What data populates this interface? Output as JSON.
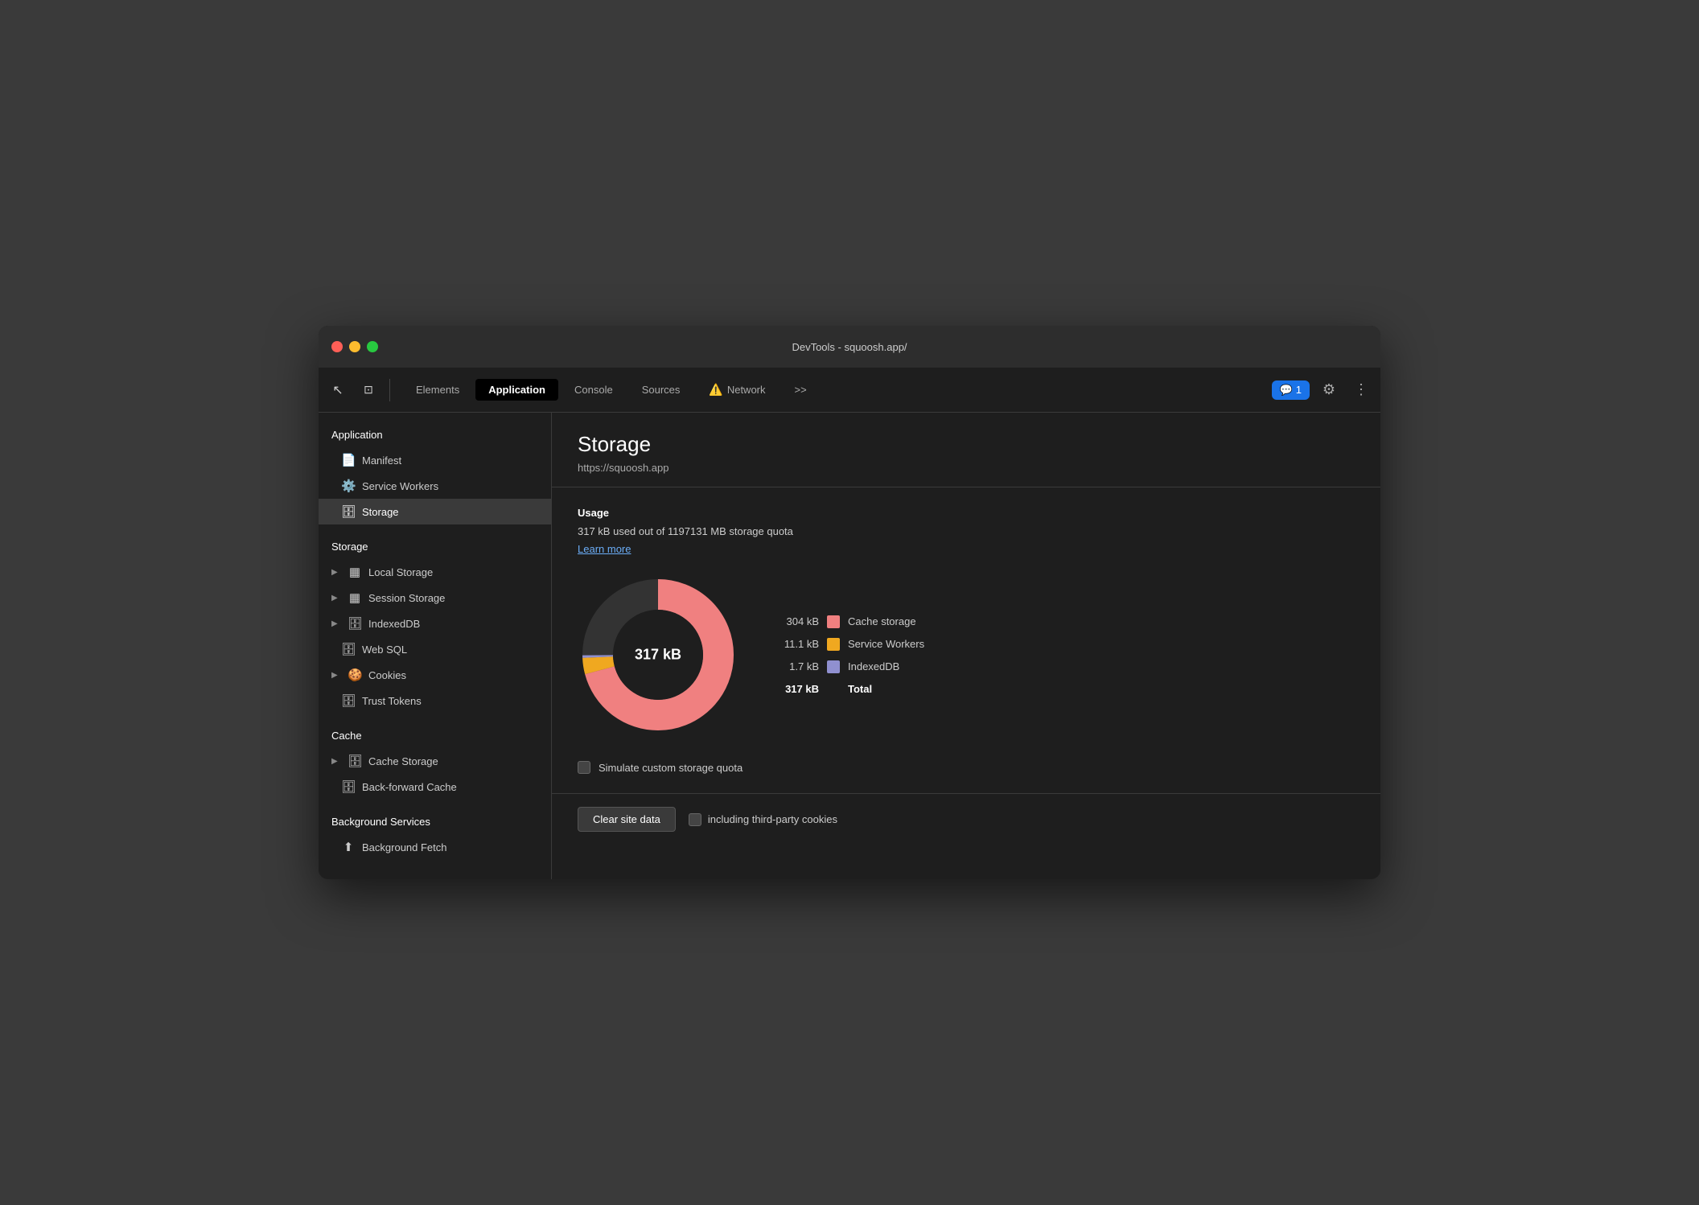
{
  "window": {
    "title": "DevTools - squoosh.app/"
  },
  "tabs": [
    {
      "id": "elements",
      "label": "Elements",
      "active": false
    },
    {
      "id": "application",
      "label": "Application",
      "active": true
    },
    {
      "id": "console",
      "label": "Console",
      "active": false
    },
    {
      "id": "sources",
      "label": "Sources",
      "active": false
    },
    {
      "id": "network",
      "label": "Network",
      "active": false
    }
  ],
  "more_tabs_label": ">>",
  "badge": {
    "icon": "💬",
    "count": "1"
  },
  "sidebar": {
    "sections": [
      {
        "label": "Application",
        "items": [
          {
            "id": "manifest",
            "label": "Manifest",
            "icon": "📄",
            "arrow": false
          },
          {
            "id": "service-workers",
            "label": "Service Workers",
            "icon": "⚙️",
            "arrow": false
          },
          {
            "id": "storage",
            "label": "Storage",
            "icon": "🗄️",
            "arrow": false,
            "active": true
          }
        ]
      },
      {
        "label": "Storage",
        "items": [
          {
            "id": "local-storage",
            "label": "Local Storage",
            "icon": "▦",
            "arrow": true
          },
          {
            "id": "session-storage",
            "label": "Session Storage",
            "icon": "▦",
            "arrow": true
          },
          {
            "id": "indexeddb",
            "label": "IndexedDB",
            "icon": "🗄️",
            "arrow": true
          },
          {
            "id": "web-sql",
            "label": "Web SQL",
            "icon": "🗄️",
            "arrow": false
          },
          {
            "id": "cookies",
            "label": "Cookies",
            "icon": "🍪",
            "arrow": true
          },
          {
            "id": "trust-tokens",
            "label": "Trust Tokens",
            "icon": "🗄️",
            "arrow": false
          }
        ]
      },
      {
        "label": "Cache",
        "items": [
          {
            "id": "cache-storage",
            "label": "Cache Storage",
            "icon": "🗄️",
            "arrow": true
          },
          {
            "id": "back-forward-cache",
            "label": "Back-forward Cache",
            "icon": "🗄️",
            "arrow": false
          }
        ]
      },
      {
        "label": "Background Services",
        "items": [
          {
            "id": "background-fetch",
            "label": "Background Fetch",
            "icon": "⬆️",
            "arrow": false
          }
        ]
      }
    ]
  },
  "content": {
    "title": "Storage",
    "url": "https://squoosh.app",
    "usage_label": "Usage",
    "usage_text": "317 kB used out of 1197131 MB storage quota",
    "learn_more": "Learn more",
    "donut_center": "317 kB",
    "legend": [
      {
        "label": "Cache storage",
        "value": "304 kB",
        "color": "#f08080"
      },
      {
        "label": "Service Workers",
        "value": "11.1 kB",
        "color": "#f0a820"
      },
      {
        "label": "IndexedDB",
        "value": "1.7 kB",
        "color": "#9090d0"
      }
    ],
    "total_value": "317 kB",
    "total_label": "Total",
    "simulate_label": "Simulate custom storage quota",
    "clear_btn": "Clear site data",
    "third_party_label": "including third-party cookies"
  },
  "icons": {
    "cursor": "↖",
    "layers": "⊞",
    "gear": "⚙",
    "more": "⋮",
    "chat": "💬"
  }
}
